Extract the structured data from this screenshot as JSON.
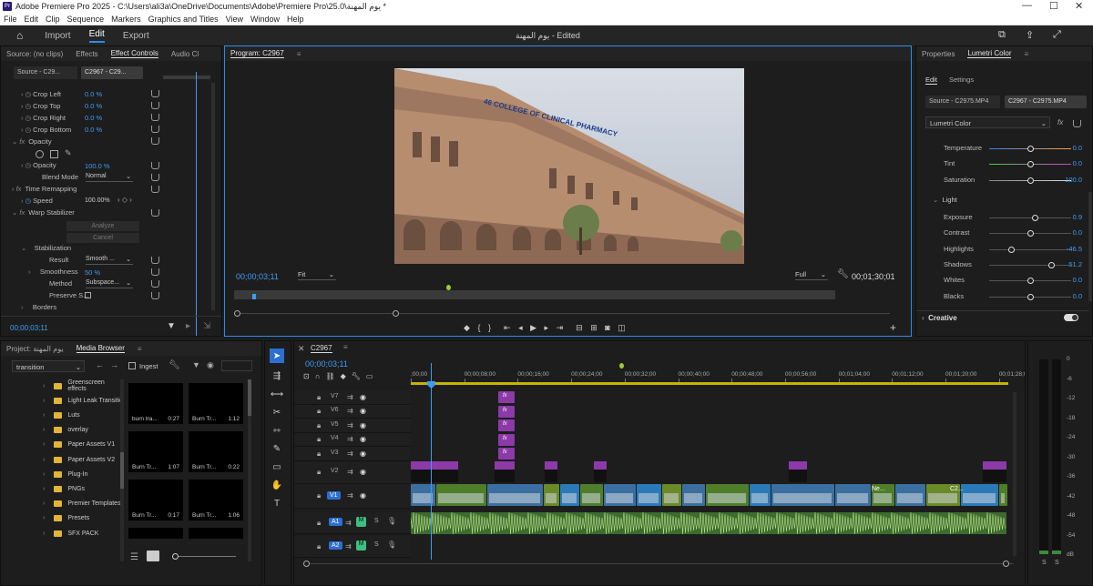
{
  "window": {
    "title": "Adobe Premiere Pro 2025 - C:\\Users\\ali3a\\OneDrive\\Documents\\Adobe\\Premiere Pro\\25.0\\يوم المهنة *",
    "app_badge": "Pr",
    "min": "—",
    "max": "☐",
    "close": "✕"
  },
  "menu": [
    "File",
    "Edit",
    "Clip",
    "Sequence",
    "Markers",
    "Graphics and Titles",
    "View",
    "Window",
    "Help"
  ],
  "header": {
    "tabs": [
      "Import",
      "Edit",
      "Export"
    ],
    "project_title": "يوم المهنة - Edited"
  },
  "left_panel": {
    "tabs": [
      "Source: (no clips)",
      "Effects",
      "Effect Controls",
      "Audio Cl"
    ],
    "source_label": "Source - C29...",
    "seq_label": "C2967 - C29...",
    "rows": [
      {
        "label": "Crop Left",
        "value": "0.0 %"
      },
      {
        "label": "Crop Top",
        "value": "0.0 %"
      },
      {
        "label": "Crop Right",
        "value": "0.0 %"
      },
      {
        "label": "Crop Bottom",
        "value": "0.0 %"
      }
    ],
    "opacity_header": "Opacity",
    "opacity_label": "Opacity",
    "opacity_value": "100.0 %",
    "blend_label": "Blend Mode",
    "blend_value": "Normal",
    "time_remap": "Time Remapping",
    "speed_label": "Speed",
    "speed_value": "100.00%",
    "warp": "Warp Stabilizer",
    "analyze": "Analyze",
    "cancel": "Cancel",
    "stabilization": "Stabilization",
    "result_label": "Result",
    "result_value": "Smooth ...",
    "smooth_label": "Smoothness",
    "smooth_value": "50 %",
    "method_label": "Method",
    "method_value": "Subspace...",
    "preserve_label": "Preserve S...",
    "borders": "Borders",
    "timecode": "00;00;03;11"
  },
  "program": {
    "tab": "Program: C2967",
    "timecode": "00;00;03;11",
    "fit": "Fit",
    "quality": "Full",
    "duration": "00;01;30;01",
    "frame_text": "46  COLLEGE OF CLINICAL PHARMACY"
  },
  "lumetri": {
    "tabs": [
      "Properties",
      "Lumetri Color"
    ],
    "subtabs": [
      "Edit",
      "Settings"
    ],
    "source": "Source - C2975.MP4",
    "seq": "C2967 - C2975.MP4",
    "effect": "Lumetri Color",
    "rows": [
      {
        "label": "Temperature",
        "value": "0.0",
        "pos": 0.5
      },
      {
        "label": "Tint",
        "value": "0.0",
        "pos": 0.5
      },
      {
        "label": "Saturation",
        "value": "100.0",
        "pos": 0.5
      }
    ],
    "light": "Light",
    "light_rows": [
      {
        "label": "Exposure",
        "value": "0.9",
        "pos": 0.56
      },
      {
        "label": "Contrast",
        "value": "0.0",
        "pos": 0.5
      },
      {
        "label": "Highlights",
        "value": "-46.5",
        "pos": 0.27
      },
      {
        "label": "Shadows",
        "value": "51.2",
        "pos": 0.75
      },
      {
        "label": "Whites",
        "value": "0.0",
        "pos": 0.5
      },
      {
        "label": "Blacks",
        "value": "0.0",
        "pos": 0.5
      }
    ],
    "creative": "Creative"
  },
  "project": {
    "tabs": [
      "Project: يوم المهنة",
      "Media Browser"
    ],
    "path": "transition",
    "ingest": "Ingest",
    "folders": [
      "Greenscreen effects",
      "Light Leak Transitio",
      "Luts",
      "overlay",
      "Paper Assets V1",
      "Paper Assets V2",
      "Plug-In",
      "PNGs",
      "Premier Templates",
      "Presets",
      "SFX PACK"
    ],
    "thumbs": [
      {
        "name": "burn tra...",
        "dur": "0:27"
      },
      {
        "name": "Burn Tr...",
        "dur": "1:12"
      },
      {
        "name": "Burn Tr...",
        "dur": "1:07"
      },
      {
        "name": "Burn Tr...",
        "dur": "0:22"
      },
      {
        "name": "Burn Tr...",
        "dur": "0:17"
      },
      {
        "name": "Burn Tr...",
        "dur": "1:06"
      }
    ]
  },
  "timeline": {
    "tab": "C2967",
    "timecode": "00;00;03;11",
    "ruler": [
      ";00;00",
      "00;00;08;00",
      "00;00;16;00",
      "00;00;24;00",
      "00;00;32;00",
      "00;00;40;00",
      "00;00;48;00",
      "00;00;56;00",
      "00;01;04;00",
      "00;01;12;00",
      "00;01;20;00",
      "00;01;28;00"
    ],
    "video_tracks": [
      "V7",
      "V6",
      "V5",
      "V4",
      "V3",
      "V2",
      "V1"
    ],
    "audio_tracks": [
      "A1",
      "A2"
    ],
    "clip_labels": [
      "Ne...",
      "C2..."
    ]
  },
  "meter": {
    "scale": [
      "0",
      "-6",
      "-12",
      "-18",
      "-24",
      "-30",
      "-36",
      "-42",
      "-48",
      "-54",
      "dB"
    ],
    "solo": "S"
  }
}
